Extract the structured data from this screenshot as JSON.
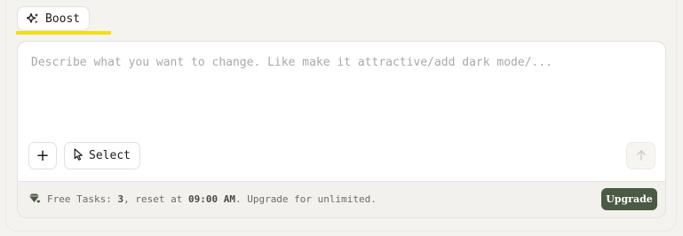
{
  "tab": {
    "label": "Boost",
    "icon": "sparkles-icon",
    "underline_color": "#f4dd16"
  },
  "composer": {
    "placeholder": "Describe what you want to change. Like make it attractive/add dark mode/...",
    "value": "",
    "add_label": "+",
    "add_icon": "plus-icon",
    "select_label": "Select",
    "select_icon": "cursor-icon",
    "send_icon": "arrow-up-icon"
  },
  "footer": {
    "icon": "diamond-heart-icon",
    "prefix": "Free Tasks: ",
    "count": "3",
    "middle": ", reset at ",
    "reset_time": "09:00 AM",
    "suffix": ". Upgrade for unlimited.",
    "upgrade_label": "Upgrade",
    "upgrade_color": "#4b5a45"
  }
}
